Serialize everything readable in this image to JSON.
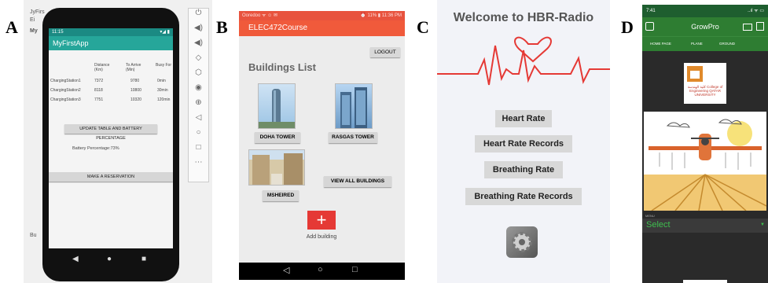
{
  "labels": [
    "A",
    "B",
    "C",
    "D"
  ],
  "panelA": {
    "ide": {
      "top_left": "JyFirs",
      "menu_frag": "Ei",
      "my": "My",
      "bu": "Bu"
    },
    "status_time": "11:15",
    "status_icons": "▾◢ ▮",
    "app_title": "MyFirstApp",
    "columns": [
      "Distance (Km)",
      "To Arrive (Min)",
      "Busy For"
    ],
    "rows": [
      {
        "name": "ChargingStation1",
        "distance": "7372",
        "arrive": "9780",
        "busy": "0min"
      },
      {
        "name": "ChargingStation2",
        "distance": "8118",
        "arrive": "10800",
        "busy": "30min"
      },
      {
        "name": "ChargingStation3",
        "distance": "7751",
        "arrive": "10320",
        "busy": "120min"
      }
    ],
    "update_button": "UPDATE TABLE AND BATTERY PERCENTAGE",
    "battery_text": "Battery Percentage:73%",
    "reserve_button": "MAKE A RESERVATION",
    "nav": {
      "back": "◀",
      "home": "●",
      "recent": "■"
    },
    "toolbar_icons": [
      "⏻",
      "◀)",
      "◀)",
      "◇",
      "⬡",
      "◉",
      "⊕",
      "◁",
      "○",
      "□",
      "⋯"
    ]
  },
  "panelB": {
    "status_left": "Ooredoo ᯤ ☺ ✉",
    "status_right": "⏰ 11% ▮ 11:36 PM",
    "app_title": "ELEC472Course",
    "logout": "LOGOUT",
    "heading": "Buildings List",
    "buildings": [
      "DOHA TOWER",
      "RASGAS TOWER",
      "MSHEIRED"
    ],
    "view_all": "VIEW ALL BUILDINGS",
    "add_icon": "+",
    "add_label": "Add building",
    "nav": {
      "back": "◁",
      "home": "○",
      "recent": "□"
    }
  },
  "panelC": {
    "title": "Welcome to HBR-Radio",
    "buttons": [
      "Heart Rate",
      "Heart Rate Records",
      "Breathing Rate",
      "Breathing Rate Records"
    ],
    "accent": "#e53935"
  },
  "panelD": {
    "time": "7:41",
    "status_right": "..ıl ᯤ ▭",
    "app_title": "GrowPro",
    "tabs": [
      "HOME PAGE",
      "PLANE",
      "GROUND"
    ],
    "logo_text": "كلية الهندسة College of Engineering QATAR UNIVERSITY",
    "menu_label": "MENU",
    "select_value": "Select",
    "accent": "#2e7d32"
  }
}
